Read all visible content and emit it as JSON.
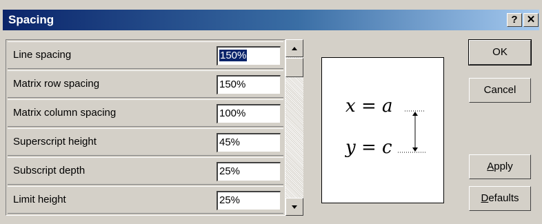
{
  "dialog": {
    "title": "Spacing",
    "help_label": "?",
    "close_label": "✕"
  },
  "rows": [
    {
      "label": "Line spacing",
      "value": "150%"
    },
    {
      "label": "Matrix row spacing",
      "value": "150%"
    },
    {
      "label": "Matrix column spacing",
      "value": "100%"
    },
    {
      "label": "Superscript height",
      "value": "45%"
    },
    {
      "label": "Subscript depth",
      "value": "25%"
    },
    {
      "label": "Limit height",
      "value": "25%"
    }
  ],
  "preview": {
    "line1_var": "x",
    "line1_op": "=",
    "line1_rhs": "a",
    "line2_var": "y",
    "line2_op": "=",
    "line2_rhs": "c"
  },
  "buttons": {
    "ok": "OK",
    "cancel": "Cancel",
    "apply": "Apply",
    "apply_mnemonic": "A",
    "defaults": "Defaults",
    "defaults_mnemonic": "D"
  },
  "colors": {
    "titlebar_start": "#0a246a",
    "titlebar_end": "#a6caf0",
    "selection": "#0a246a"
  }
}
